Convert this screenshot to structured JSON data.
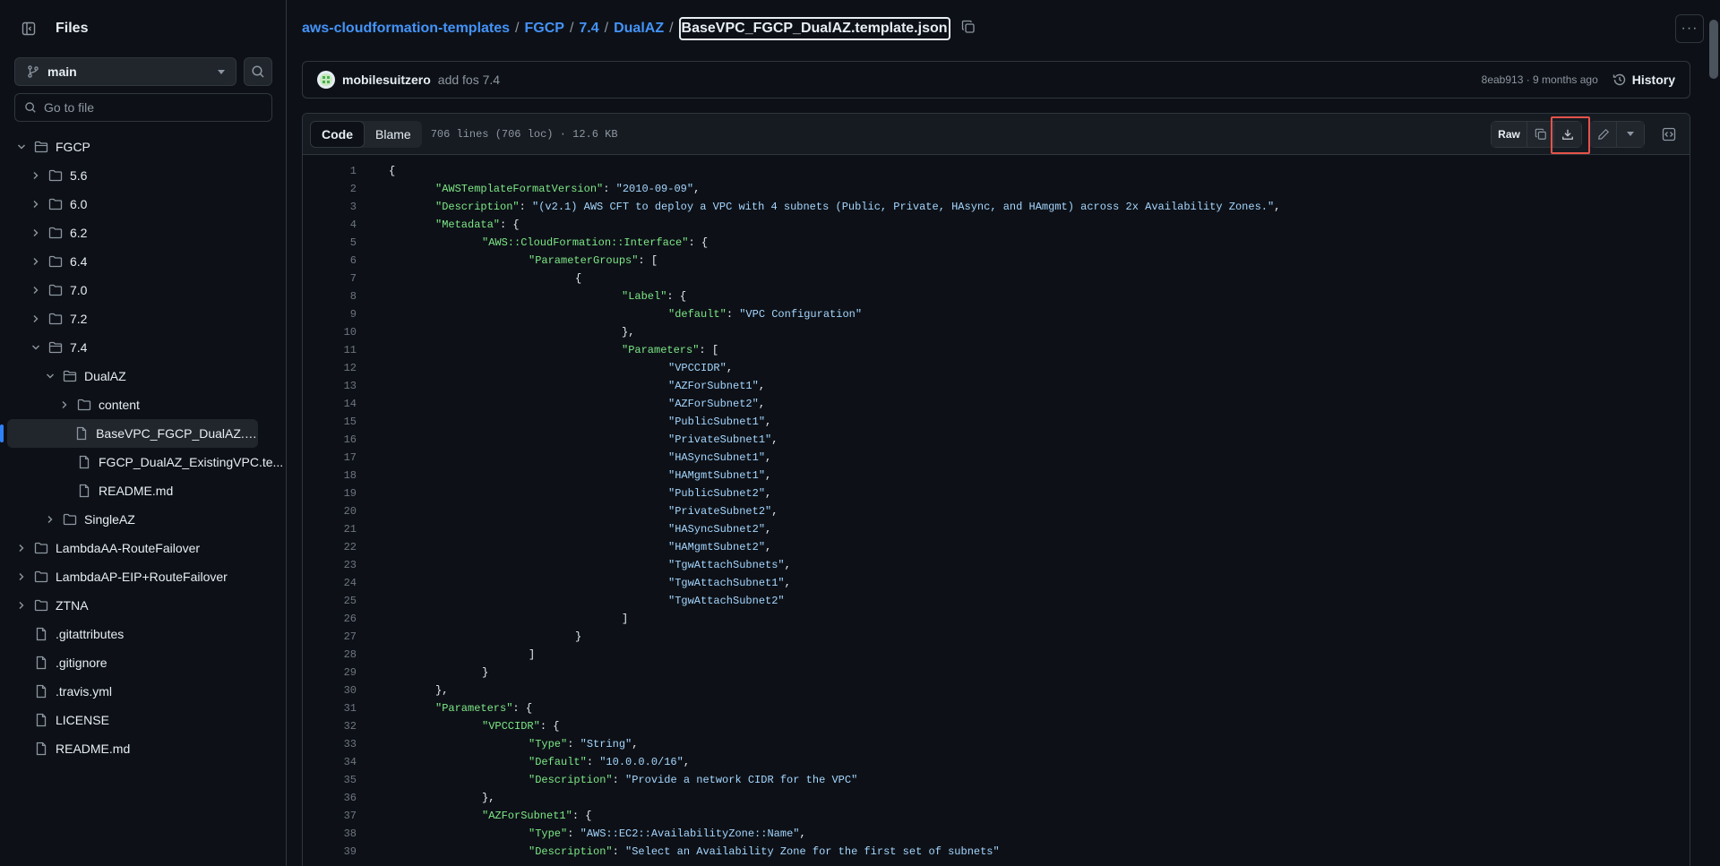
{
  "sidebar": {
    "title": "Files",
    "branch": "main",
    "goto_placeholder": "Go to file",
    "tree": [
      {
        "label": "FGCP",
        "depth": 0,
        "type": "folder",
        "expanded": true
      },
      {
        "label": "5.6",
        "depth": 1,
        "type": "folder",
        "expanded": false
      },
      {
        "label": "6.0",
        "depth": 1,
        "type": "folder",
        "expanded": false
      },
      {
        "label": "6.2",
        "depth": 1,
        "type": "folder",
        "expanded": false
      },
      {
        "label": "6.4",
        "depth": 1,
        "type": "folder",
        "expanded": false
      },
      {
        "label": "7.0",
        "depth": 1,
        "type": "folder",
        "expanded": false
      },
      {
        "label": "7.2",
        "depth": 1,
        "type": "folder",
        "expanded": false
      },
      {
        "label": "7.4",
        "depth": 1,
        "type": "folder",
        "expanded": true
      },
      {
        "label": "DualAZ",
        "depth": 2,
        "type": "folder",
        "expanded": true
      },
      {
        "label": "content",
        "depth": 3,
        "type": "folder",
        "expanded": false
      },
      {
        "label": "BaseVPC_FGCP_DualAZ.temp...",
        "depth": 3,
        "type": "file",
        "selected": true
      },
      {
        "label": "FGCP_DualAZ_ExistingVPC.te...",
        "depth": 3,
        "type": "file"
      },
      {
        "label": "README.md",
        "depth": 3,
        "type": "file"
      },
      {
        "label": "SingleAZ",
        "depth": 2,
        "type": "folder",
        "expanded": false
      },
      {
        "label": "LambdaAA-RouteFailover",
        "depth": 0,
        "type": "folder",
        "expanded": false
      },
      {
        "label": "LambdaAP-EIP+RouteFailover",
        "depth": 0,
        "type": "folder",
        "expanded": false
      },
      {
        "label": "ZTNA",
        "depth": 0,
        "type": "folder",
        "expanded": false
      },
      {
        "label": ".gitattributes",
        "depth": 0,
        "type": "file"
      },
      {
        "label": ".gitignore",
        "depth": 0,
        "type": "file"
      },
      {
        "label": ".travis.yml",
        "depth": 0,
        "type": "file"
      },
      {
        "label": "LICENSE",
        "depth": 0,
        "type": "file"
      },
      {
        "label": "README.md",
        "depth": 0,
        "type": "file"
      }
    ]
  },
  "breadcrumb": {
    "repo": "aws-cloudformation-templates",
    "parts": [
      "FGCP",
      "7.4",
      "DualAZ"
    ],
    "current": "BaseVPC_FGCP_DualAZ.template.json"
  },
  "commit": {
    "author": "mobilesuitzero",
    "message": "add fos 7.4",
    "sha_time": "8eab913 · 9 months ago",
    "history_label": "History"
  },
  "file": {
    "tab_code": "Code",
    "tab_blame": "Blame",
    "meta": "706 lines (706 loc) · 12.6 KB",
    "raw_label": "Raw"
  },
  "code_lines": [
    {
      "n": "1",
      "indent": 0,
      "parts": [
        [
          "p",
          "{"
        ]
      ]
    },
    {
      "n": "2",
      "indent": 1,
      "parts": [
        [
          "k",
          "\"AWSTemplateFormatVersion\""
        ],
        [
          "p",
          ": "
        ],
        [
          "s",
          "\"2010-09-09\""
        ],
        [
          "p",
          ","
        ]
      ]
    },
    {
      "n": "3",
      "indent": 1,
      "parts": [
        [
          "k",
          "\"Description\""
        ],
        [
          "p",
          ": "
        ],
        [
          "s",
          "\"(v2.1) AWS CFT to deploy a VPC with 4 subnets (Public, Private, HAsync, and HAmgmt) across 2x Availability Zones.\""
        ],
        [
          "p",
          ","
        ]
      ]
    },
    {
      "n": "4",
      "indent": 1,
      "parts": [
        [
          "k",
          "\"Metadata\""
        ],
        [
          "p",
          ": {"
        ]
      ]
    },
    {
      "n": "5",
      "indent": 2,
      "parts": [
        [
          "k",
          "\"AWS::CloudFormation::Interface\""
        ],
        [
          "p",
          ": {"
        ]
      ]
    },
    {
      "n": "6",
      "indent": 3,
      "parts": [
        [
          "k",
          "\"ParameterGroups\""
        ],
        [
          "p",
          ": ["
        ]
      ]
    },
    {
      "n": "7",
      "indent": 4,
      "parts": [
        [
          "p",
          "{"
        ]
      ]
    },
    {
      "n": "8",
      "indent": 5,
      "parts": [
        [
          "k",
          "\"Label\""
        ],
        [
          "p",
          ": {"
        ]
      ]
    },
    {
      "n": "9",
      "indent": 6,
      "parts": [
        [
          "k",
          "\"default\""
        ],
        [
          "p",
          ": "
        ],
        [
          "s",
          "\"VPC Configuration\""
        ]
      ]
    },
    {
      "n": "10",
      "indent": 5,
      "parts": [
        [
          "p",
          "},"
        ]
      ]
    },
    {
      "n": "11",
      "indent": 5,
      "parts": [
        [
          "k",
          "\"Parameters\""
        ],
        [
          "p",
          ": ["
        ]
      ]
    },
    {
      "n": "12",
      "indent": 6,
      "parts": [
        [
          "s",
          "\"VPCCIDR\""
        ],
        [
          "p",
          ","
        ]
      ]
    },
    {
      "n": "13",
      "indent": 6,
      "parts": [
        [
          "s",
          "\"AZForSubnet1\""
        ],
        [
          "p",
          ","
        ]
      ]
    },
    {
      "n": "14",
      "indent": 6,
      "parts": [
        [
          "s",
          "\"AZForSubnet2\""
        ],
        [
          "p",
          ","
        ]
      ]
    },
    {
      "n": "15",
      "indent": 6,
      "parts": [
        [
          "s",
          "\"PublicSubnet1\""
        ],
        [
          "p",
          ","
        ]
      ]
    },
    {
      "n": "16",
      "indent": 6,
      "parts": [
        [
          "s",
          "\"PrivateSubnet1\""
        ],
        [
          "p",
          ","
        ]
      ]
    },
    {
      "n": "17",
      "indent": 6,
      "parts": [
        [
          "s",
          "\"HASyncSubnet1\""
        ],
        [
          "p",
          ","
        ]
      ]
    },
    {
      "n": "18",
      "indent": 6,
      "parts": [
        [
          "s",
          "\"HAMgmtSubnet1\""
        ],
        [
          "p",
          ","
        ]
      ]
    },
    {
      "n": "19",
      "indent": 6,
      "parts": [
        [
          "s",
          "\"PublicSubnet2\""
        ],
        [
          "p",
          ","
        ]
      ]
    },
    {
      "n": "20",
      "indent": 6,
      "parts": [
        [
          "s",
          "\"PrivateSubnet2\""
        ],
        [
          "p",
          ","
        ]
      ]
    },
    {
      "n": "21",
      "indent": 6,
      "parts": [
        [
          "s",
          "\"HASyncSubnet2\""
        ],
        [
          "p",
          ","
        ]
      ]
    },
    {
      "n": "22",
      "indent": 6,
      "parts": [
        [
          "s",
          "\"HAMgmtSubnet2\""
        ],
        [
          "p",
          ","
        ]
      ]
    },
    {
      "n": "23",
      "indent": 6,
      "parts": [
        [
          "s",
          "\"TgwAttachSubnets\""
        ],
        [
          "p",
          ","
        ]
      ]
    },
    {
      "n": "24",
      "indent": 6,
      "parts": [
        [
          "s",
          "\"TgwAttachSubnet1\""
        ],
        [
          "p",
          ","
        ]
      ]
    },
    {
      "n": "25",
      "indent": 6,
      "parts": [
        [
          "s",
          "\"TgwAttachSubnet2\""
        ]
      ]
    },
    {
      "n": "26",
      "indent": 5,
      "parts": [
        [
          "p",
          "]"
        ]
      ]
    },
    {
      "n": "27",
      "indent": 4,
      "parts": [
        [
          "p",
          "}"
        ]
      ]
    },
    {
      "n": "28",
      "indent": 3,
      "parts": [
        [
          "p",
          "]"
        ]
      ]
    },
    {
      "n": "29",
      "indent": 2,
      "parts": [
        [
          "p",
          "}"
        ]
      ]
    },
    {
      "n": "30",
      "indent": 1,
      "parts": [
        [
          "p",
          "},"
        ]
      ]
    },
    {
      "n": "31",
      "indent": 1,
      "parts": [
        [
          "k",
          "\"Parameters\""
        ],
        [
          "p",
          ": {"
        ]
      ]
    },
    {
      "n": "32",
      "indent": 2,
      "parts": [
        [
          "k",
          "\"VPCCIDR\""
        ],
        [
          "p",
          ": {"
        ]
      ]
    },
    {
      "n": "33",
      "indent": 3,
      "parts": [
        [
          "k",
          "\"Type\""
        ],
        [
          "p",
          ": "
        ],
        [
          "s",
          "\"String\""
        ],
        [
          "p",
          ","
        ]
      ]
    },
    {
      "n": "34",
      "indent": 3,
      "parts": [
        [
          "k",
          "\"Default\""
        ],
        [
          "p",
          ": "
        ],
        [
          "s",
          "\"10.0.0.0/16\""
        ],
        [
          "p",
          ","
        ]
      ]
    },
    {
      "n": "35",
      "indent": 3,
      "parts": [
        [
          "k",
          "\"Description\""
        ],
        [
          "p",
          ": "
        ],
        [
          "s",
          "\"Provide a network CIDR for the VPC\""
        ]
      ]
    },
    {
      "n": "36",
      "indent": 2,
      "parts": [
        [
          "p",
          "},"
        ]
      ]
    },
    {
      "n": "37",
      "indent": 2,
      "parts": [
        [
          "k",
          "\"AZForSubnet1\""
        ],
        [
          "p",
          ": {"
        ]
      ]
    },
    {
      "n": "38",
      "indent": 3,
      "parts": [
        [
          "k",
          "\"Type\""
        ],
        [
          "p",
          ": "
        ],
        [
          "s",
          "\"AWS::EC2::AvailabilityZone::Name\""
        ],
        [
          "p",
          ","
        ]
      ]
    },
    {
      "n": "39",
      "indent": 3,
      "parts": [
        [
          "k",
          "\"Description\""
        ],
        [
          "p",
          ": "
        ],
        [
          "s",
          "\"Select an Availability Zone for the first set of subnets\""
        ]
      ]
    }
  ]
}
